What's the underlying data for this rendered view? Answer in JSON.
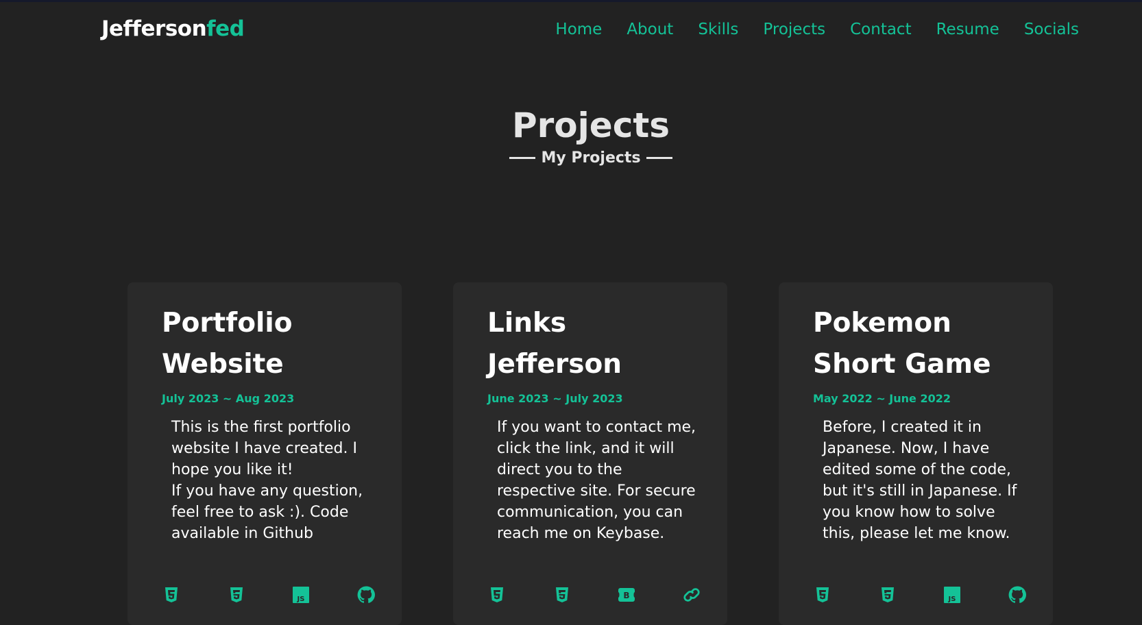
{
  "brand": {
    "name": "Jefferson",
    "accent": "fed"
  },
  "nav": {
    "items": [
      {
        "label": "Home"
      },
      {
        "label": "About"
      },
      {
        "label": "Skills"
      },
      {
        "label": "Projects"
      },
      {
        "label": "Contact"
      },
      {
        "label": "Resume"
      },
      {
        "label": "Socials"
      }
    ]
  },
  "section": {
    "title": "Projects",
    "subtitle": "My Projects"
  },
  "projects": [
    {
      "title": "Portfolio Website",
      "date": "July 2023 ~ Aug 2023",
      "description_lines": [
        "This is the first portfolio website I have created. I hope you like it!",
        "If you have any question, feel free to ask :). Code available in Github"
      ],
      "icons": [
        "html5-icon",
        "css3-icon",
        "javascript-icon",
        "github-icon"
      ]
    },
    {
      "title": "Links Jefferson",
      "date": "June 2023 ~ July 2023",
      "description_lines": [
        "If you want to contact me, click the link, and it will direct you to the respective site. For secure communication, you can reach me on Keybase."
      ],
      "icons": [
        "html5-icon",
        "css3-icon",
        "bootstrap-icon",
        "link-icon"
      ]
    },
    {
      "title": "Pokemon Short Game",
      "date": "May 2022 ~ June 2022",
      "description_lines": [
        "Before, I created it in Japanese. Now, I have edited some of the code, but it's still in Japanese. If you know how to solve this, please let me know."
      ],
      "icons": [
        "html5-icon",
        "css3-icon",
        "javascript-icon",
        "github-icon"
      ]
    }
  ],
  "colors": {
    "accent": "#14c297",
    "background": "#222222",
    "card": "#2a2a2a"
  }
}
